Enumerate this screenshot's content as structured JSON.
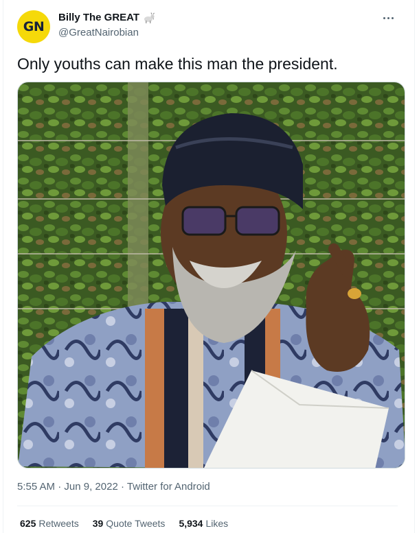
{
  "author": {
    "avatar_text": "GN",
    "avatar_color": "#f5d90a",
    "display_name": "Billy The GREAT",
    "badge_icon": "goat-icon",
    "handle": "@GreatNairobian"
  },
  "more_icon": "more-dots-icon",
  "tweet": {
    "text": "Only youths can make this man the president.",
    "media_description_icon": "tweet-photo"
  },
  "meta": {
    "time": "5:55 AM",
    "sep1": " · ",
    "date": "Jun 9, 2022",
    "sep2": " · ",
    "source": "Twitter for Android"
  },
  "stats": {
    "retweets_count": "625",
    "retweets_label": "Retweets",
    "quotes_count": "39",
    "quotes_label": "Quote Tweets",
    "likes_count": "5,934",
    "likes_label": "Likes"
  },
  "colors": {
    "text_primary": "#0f1419",
    "text_secondary": "#536471",
    "border": "#eff3f4"
  }
}
